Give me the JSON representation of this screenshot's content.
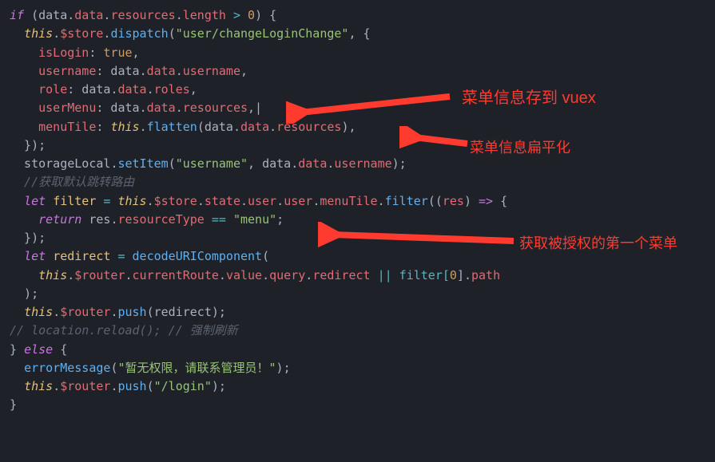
{
  "code": {
    "l1": {
      "a": "if",
      "b": " (data",
      "c": ".",
      "d": "data",
      "e": ".",
      "f": "resources",
      "g": ".",
      "h": "length",
      "i": " > ",
      "j": "0",
      "k": ") {"
    },
    "l2": {
      "a": "  ",
      "b": "this",
      "c": ".",
      "d": "$store",
      "e": ".",
      "f": "dispatch",
      "g": "(",
      "h": "\"user/changeLoginChange\"",
      "i": ", {"
    },
    "l3": {
      "a": "    ",
      "b": "isLogin",
      "c": ": ",
      "d": "true",
      "e": ","
    },
    "l4": {
      "a": "    ",
      "b": "username",
      "c": ": data",
      "d": ".",
      "e": "data",
      "f": ".",
      "g": "username",
      "h": ","
    },
    "l5": {
      "a": "    ",
      "b": "role",
      "c": ": data",
      "d": ".",
      "e": "data",
      "f": ".",
      "g": "roles",
      "h": ","
    },
    "l6": {
      "a": "    ",
      "b": "userMenu",
      "c": ": data",
      "d": ".",
      "e": "data",
      "f": ".",
      "g": "resources",
      "h": ",|"
    },
    "l7": {
      "a": "    ",
      "b": "menuTile",
      "c": ": ",
      "d": "this",
      "e": ".",
      "f": "flatten",
      "g": "(data",
      "h": ".",
      "i": "data",
      "j": ".",
      "k": "resources",
      "l": "),"
    },
    "l8": {
      "a": "  });"
    },
    "l9": {
      "a": "  storageLocal",
      "b": ".",
      "c": "setItem",
      "d": "(",
      "e": "\"username\"",
      "f": ", data",
      "g": ".",
      "h": "data",
      "i": ".",
      "j": "username",
      "k": ");"
    },
    "l10": {
      "a": "  //获取默认跳转路由"
    },
    "l11": {
      "a": "  ",
      "b": "let",
      "c": " ",
      "d": "filter",
      "e": " = ",
      "f": "this",
      "g": ".",
      "h": "$store",
      "i": ".",
      "j": "state",
      "k": ".",
      "l": "user",
      "m": ".",
      "n": "user",
      "o": ".",
      "p": "menuTile",
      "q": ".",
      "r": "filter",
      "s": "((",
      "t": "res",
      "u": ") ",
      "v": "=>",
      "w": " {"
    },
    "l12": {
      "a": "    ",
      "b": "return",
      "c": " res",
      "d": ".",
      "e": "resourceType",
      "f": " == ",
      "g": "\"menu\"",
      "h": ";"
    },
    "l13": {
      "a": "  });"
    },
    "l14": {
      "a": "  ",
      "b": "let",
      "c": " ",
      "d": "redirect",
      "e": " = ",
      "f": "decodeURIComponent",
      "g": "("
    },
    "l15": {
      "a": "    ",
      "b": "this",
      "c": ".",
      "d": "$router",
      "e": ".",
      "f": "currentRoute",
      "g": ".",
      "h": "value",
      "i": ".",
      "j": "query",
      "k": ".",
      "l": "redirect",
      "m": " || filter[",
      "n": "0",
      "o": "]",
      "p": ".",
      "q": "path"
    },
    "l16": {
      "a": "  );"
    },
    "l17": {
      "a": "  ",
      "b": "this",
      "c": ".",
      "d": "$router",
      "e": ".",
      "f": "push",
      "g": "(redirect);"
    },
    "l18": {
      "a": "// location.reload(); // 强制刷新"
    },
    "l19": {
      "a": "} ",
      "b": "else",
      "c": " {"
    },
    "l20": {
      "a": "  ",
      "b": "errorMessage",
      "c": "(",
      "d": "\"暂无权限，请联系管理员！\"",
      "e": ");"
    },
    "l21": {
      "a": "  ",
      "b": "this",
      "c": ".",
      "d": "$router",
      "e": ".",
      "f": "push",
      "g": "(",
      "h": "\"/login\"",
      "i": ");"
    },
    "l22": {
      "a": "}"
    }
  },
  "annotations": {
    "a1": "菜单信息存到 vuex",
    "a2": "菜单信息扁平化",
    "a3": "获取被授权的第一个菜单"
  }
}
